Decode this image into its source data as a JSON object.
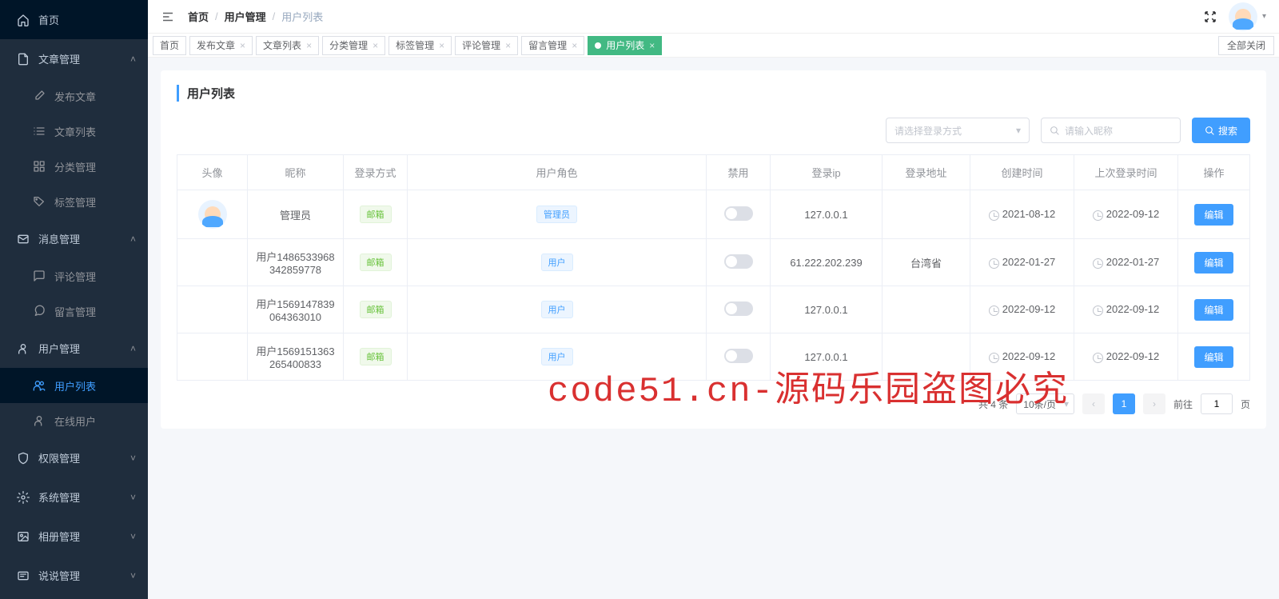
{
  "sidebar": {
    "items": [
      {
        "label": "首页",
        "icon": "home",
        "type": "item"
      },
      {
        "label": "文章管理",
        "icon": "document",
        "type": "group",
        "open": true
      },
      {
        "label": "发布文章",
        "icon": "edit",
        "type": "sub"
      },
      {
        "label": "文章列表",
        "icon": "list",
        "type": "sub"
      },
      {
        "label": "分类管理",
        "icon": "grid",
        "type": "sub"
      },
      {
        "label": "标签管理",
        "icon": "tag",
        "type": "sub"
      },
      {
        "label": "消息管理",
        "icon": "mail",
        "type": "group",
        "open": true
      },
      {
        "label": "评论管理",
        "icon": "comment",
        "type": "sub"
      },
      {
        "label": "留言管理",
        "icon": "chat",
        "type": "sub"
      },
      {
        "label": "用户管理",
        "icon": "user",
        "type": "group",
        "open": true
      },
      {
        "label": "用户列表",
        "icon": "users",
        "type": "sub",
        "active": true
      },
      {
        "label": "在线用户",
        "icon": "user",
        "type": "sub"
      },
      {
        "label": "权限管理",
        "icon": "shield",
        "type": "group",
        "open": false
      },
      {
        "label": "系统管理",
        "icon": "gear",
        "type": "group",
        "open": false
      },
      {
        "label": "相册管理",
        "icon": "image",
        "type": "group",
        "open": false
      },
      {
        "label": "说说管理",
        "icon": "message",
        "type": "group",
        "open": false
      }
    ]
  },
  "breadcrumb": {
    "home": "首页",
    "mid": "用户管理",
    "last": "用户列表"
  },
  "tabs": {
    "items": [
      {
        "label": "首页",
        "closable": false
      },
      {
        "label": "发布文章",
        "closable": true
      },
      {
        "label": "文章列表",
        "closable": true
      },
      {
        "label": "分类管理",
        "closable": true
      },
      {
        "label": "标签管理",
        "closable": true
      },
      {
        "label": "评论管理",
        "closable": true
      },
      {
        "label": "留言管理",
        "closable": true
      },
      {
        "label": "用户列表",
        "closable": true,
        "active": true
      }
    ],
    "closeAll": "全部关闭"
  },
  "page": {
    "title": "用户列表",
    "loginSelectPlaceholder": "请选择登录方式",
    "nicknamePlaceholder": "请输入昵称",
    "searchBtn": "搜索"
  },
  "table": {
    "headers": {
      "avatar": "头像",
      "nickname": "昵称",
      "loginType": "登录方式",
      "role": "用户角色",
      "disabled": "禁用",
      "loginIp": "登录ip",
      "loginAddr": "登录地址",
      "createTime": "创建时间",
      "lastLogin": "上次登录时间",
      "ops": "操作"
    },
    "rows": [
      {
        "nickname": "管理员",
        "loginType": "邮箱",
        "role": "管理员",
        "roleType": "admin",
        "ip": "127.0.0.1",
        "addr": "",
        "create": "2021-08-12",
        "last": "2022-09-12",
        "avatarStyle": "circle"
      },
      {
        "nickname": "用户1486533968342859778",
        "loginType": "邮箱",
        "role": "用户",
        "roleType": "user",
        "ip": "61.222.202.239",
        "addr": "台湾省",
        "create": "2022-01-27",
        "last": "2022-01-27",
        "avatarStyle": "square1"
      },
      {
        "nickname": "用户1569147839064363010",
        "loginType": "邮箱",
        "role": "用户",
        "roleType": "user",
        "ip": "127.0.0.1",
        "addr": "",
        "create": "2022-09-12",
        "last": "2022-09-12",
        "avatarStyle": "square2"
      },
      {
        "nickname": "用户1569151363265400833",
        "loginType": "邮箱",
        "role": "用户",
        "roleType": "user",
        "ip": "127.0.0.1",
        "addr": "",
        "create": "2022-09-12",
        "last": "2022-09-12",
        "avatarStyle": "square2"
      }
    ],
    "editBtn": "编辑"
  },
  "pagination": {
    "total": "共 4 条",
    "perPage": "10条/页",
    "page": "1",
    "goto": "前往",
    "gotoValue": "1",
    "pageSuffix": "页"
  },
  "watermark": "code51.cn-源码乐园盗图必究"
}
